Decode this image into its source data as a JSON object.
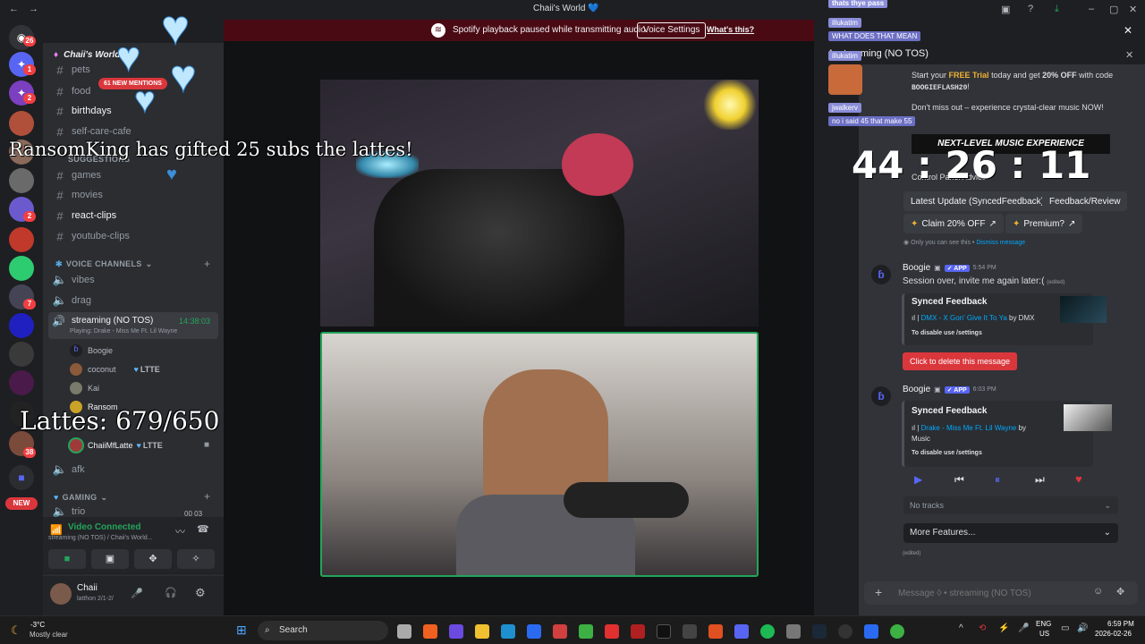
{
  "window": {
    "title": "Chaii's World 💙"
  },
  "banner": {
    "text": "Spotify playback paused while transmitting audio.",
    "voice_settings": "Voice Settings",
    "whats_this": "What's this?"
  },
  "servers": {
    "badges": [
      "26",
      "1",
      "2",
      "2",
      "7",
      "38"
    ],
    "new_label": "NEW"
  },
  "sidebar": {
    "server_name": "Chaii's World",
    "new_mentions": "61 NEW MENTIONS",
    "channels_top": [
      "pets",
      "food",
      "birthdays",
      "self-care-cafe"
    ],
    "suggestions_cat": "SUGGESTIONS",
    "channels_mid": [
      "games",
      "movies",
      "react-clips",
      "youtube-clips"
    ],
    "voice_cat": "VOICE CHANNELS",
    "voice_channels": [
      "vibes",
      "drag"
    ],
    "streaming_channel": "streaming (NO TOS)",
    "streaming_time": "14:38:03",
    "playing": "Playing: Drake - Miss Me Ft. Lil Wayne",
    "voice_users": [
      "Boogie",
      "coconut",
      "Kai",
      "Ransom",
      "ChaiiMfLatte"
    ],
    "ltte": "LTTE",
    "afk": "afk",
    "gaming_cat": "GAMING",
    "trio": "trio",
    "trio_count": "00  03"
  },
  "voice_panel": {
    "status": "Video Connected",
    "channel": "streaming (NO TOS) / Chaii's World..."
  },
  "user": {
    "name": "Chaii",
    "status": "latthon 2/1-2/"
  },
  "overlay": {
    "gift_name": "RansomKing",
    "gift_text": "has gifted",
    "gift_count": "25",
    "gift_suffix": "subs the lattes!",
    "lattes_label": "Lattes:",
    "lattes_value": "679/650",
    "timer": "44 : 26 : 11"
  },
  "right_panel": {
    "notifs": [
      "thats thye pass",
      "illukatim",
      "WHAT DOES THAT MEAN",
      "illukatim",
      "jwalkerv",
      "no i said 45 that make 55"
    ],
    "header_channel": "streaming (NO TOS)",
    "promo_1": "Start your",
    "promo_free": "FREE Trial",
    "promo_2": "today and get",
    "promo_off": "20% OFF",
    "promo_3": "with code",
    "promo_code": "BOOGIEFLASH20",
    "promo_4": "Don't miss out – experience crystal-clear music NOW!",
    "promo_banner": "NEXT-LEVEL MUSIC EXPERIENCE",
    "control_panel": "Control Panel Advice",
    "buttons": [
      "Latest Update (SyncedFeedback)",
      "Feedback/Review",
      "Claim 20% OFF",
      "Premium?"
    ],
    "only_you": "Only you can see this • ",
    "dismiss": "Dismiss message",
    "messages": [
      {
        "author": "Boogie",
        "app": "APP",
        "time": "5:54 PM",
        "text": "Session over, invite me again later:(",
        "edited": "(edited)"
      },
      {
        "author": "Boogie",
        "app": "APP",
        "time": "6:03 PM"
      }
    ],
    "card1": {
      "title": "Synced Feedback",
      "track": "DMX - X Gon' Give It To Ya",
      "by": "by DMX",
      "disable": "To disable use /settings"
    },
    "delete_btn": "Click to delete this message",
    "card2": {
      "title": "Synced Feedback",
      "track": "Drake - Miss Me Ft. Lil Wayne",
      "by": "by Music",
      "disable": "To disable use /settings"
    },
    "no_tracks": "No tracks",
    "more_features": "More Features...",
    "edited": "(edited)",
    "input_placeholder": "Message ◊ • streaming (NO TOS)"
  },
  "taskbar": {
    "weather_temp": "-3°C",
    "weather_desc": "Mostly clear",
    "search": "Search",
    "lang1": "ENG",
    "lang2": "US",
    "time": "6:59 PM",
    "date": "2026-02-26"
  },
  "colors": {
    "accent": "#5865f2",
    "danger": "#da373c",
    "green": "#23a55a",
    "banner": "#4a0a14"
  }
}
